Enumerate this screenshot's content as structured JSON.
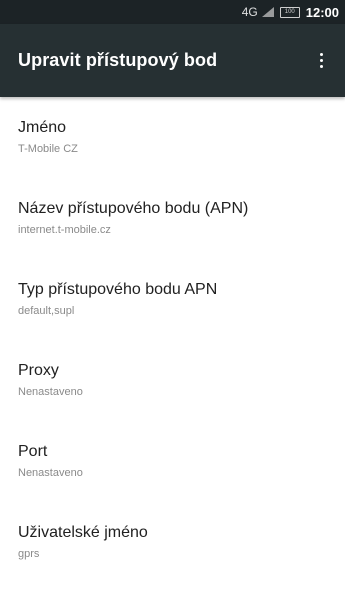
{
  "status_bar": {
    "network_superscript": "4G",
    "network": "4G",
    "battery": "100",
    "time": "12:00"
  },
  "toolbar": {
    "title": "Upravit přístupový bod",
    "more_icon": "more-vert-icon"
  },
  "settings": [
    {
      "label": "Jméno",
      "value": "T-Mobile CZ"
    },
    {
      "label": "Název přístupového bodu (APN)",
      "value": "internet.t-mobile.cz"
    },
    {
      "label": "Typ přístupového bodu APN",
      "value": "default,supl"
    },
    {
      "label": "Proxy",
      "value": "Nenastaveno"
    },
    {
      "label": "Port",
      "value": "Nenastaveno"
    },
    {
      "label": "Uživatelské jméno",
      "value": "gprs"
    }
  ]
}
